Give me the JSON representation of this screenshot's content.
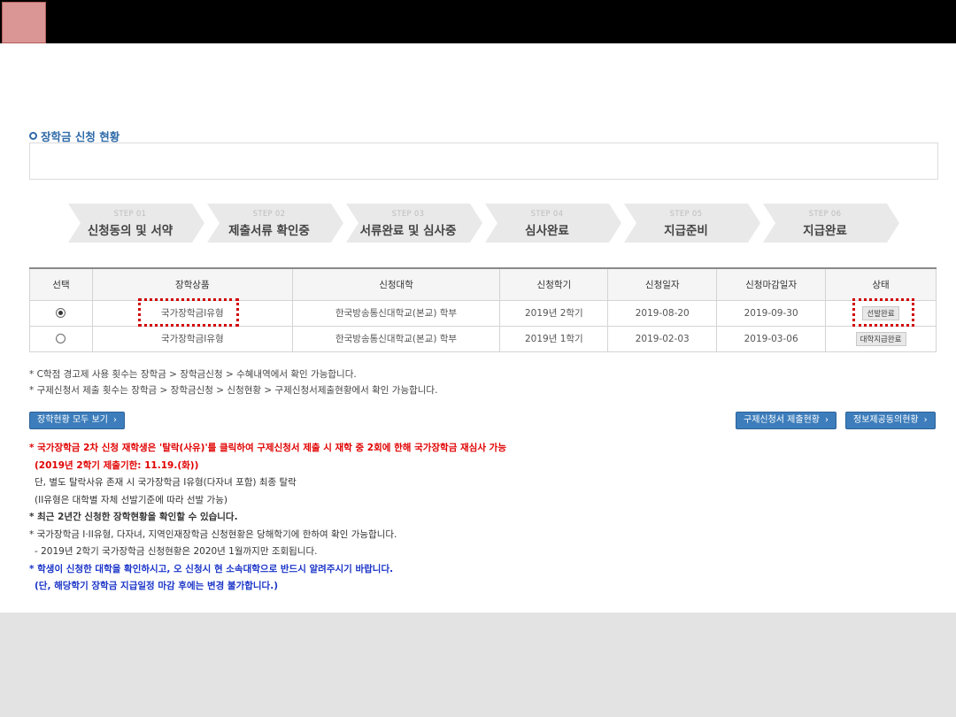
{
  "section": {
    "title": "장학금 신청 현황"
  },
  "steps": [
    {
      "num": "STEP 01",
      "label": "신청동의 및 서약"
    },
    {
      "num": "STEP 02",
      "label": "제출서류 확인중"
    },
    {
      "num": "STEP 03",
      "label": "서류완료 및 심사중"
    },
    {
      "num": "STEP 04",
      "label": "심사완료"
    },
    {
      "num": "STEP 05",
      "label": "지급준비"
    },
    {
      "num": "STEP 06",
      "label": "지급완료"
    }
  ],
  "table": {
    "headers": [
      "선택",
      "장학상품",
      "신청대학",
      "신청학기",
      "신청일자",
      "신청마감일자",
      "상태"
    ],
    "rows": [
      {
        "selected": true,
        "product": "국가장학금I유형",
        "univ": "한국방송통신대학교(본교) 학부",
        "term": "2019년 2학기",
        "date": "2019-08-20",
        "deadline": "2019-09-30",
        "status": "선발완료"
      },
      {
        "selected": false,
        "product": "국가장학금I유형",
        "univ": "한국방송통신대학교(본교) 학부",
        "term": "2019년 1학기",
        "date": "2019-02-03",
        "deadline": "2019-03-06",
        "status": "대학지급완료"
      }
    ]
  },
  "footnotes": [
    "* C학점 경고제 사용 횟수는 장학금 > 장학금신청 > 수혜내역에서 확인 가능합니다.",
    "* 구제신청서 제출 횟수는 장학금 > 장학금신청 > 신청현황 > 구제신청서제출현황에서 확인 가능합니다."
  ],
  "buttons": {
    "view_all": "장학현황 모두 보기",
    "relief": "구제신청서 제출현황",
    "info_consent": "정보제공동의현황",
    "arrow": "›"
  },
  "notes": {
    "line1": "* 국가장학금 2차 신청 재학생은 '탈락(사유)'를 클릭하여 구제신청서 제출 시 재학 중 2회에 한해 국가장학금 재심사 가능",
    "line2": "(2019년 2학기 제출기한: 11.19.(화))",
    "line3": "단, 별도 탈락사유 존재 시 국가장학금 I유형(다자녀 포함) 최종 탈락",
    "line4": "(II유형은 대학별 자체 선발기준에 따라 선발 가능)",
    "line5": "* 최근 2년간 신청한 장학현황을 확인할 수 있습니다.",
    "line6": "* 국가장학금 I·II유형, 다자녀, 지역인재장학금 신청현황은 당해학기에 한하여 확인 가능합니다.",
    "line7": "- 2019년 2학기 국가장학금 신청현황은 2020년 1월까지만 조회됩니다.",
    "line8": "* 학생이 신청한 대학을 확인하시고, 오 신청시 현 소속대학으로 반드시 알려주시기 바랍니다.",
    "line9": "(단, 해당학기 장학금 지급일정 마감 후에는 변경 불가합니다.)"
  },
  "colors": {
    "accent_blue": "#3d7dbb",
    "highlight_red": "#d10000",
    "title_blue": "#2e6aa8"
  }
}
